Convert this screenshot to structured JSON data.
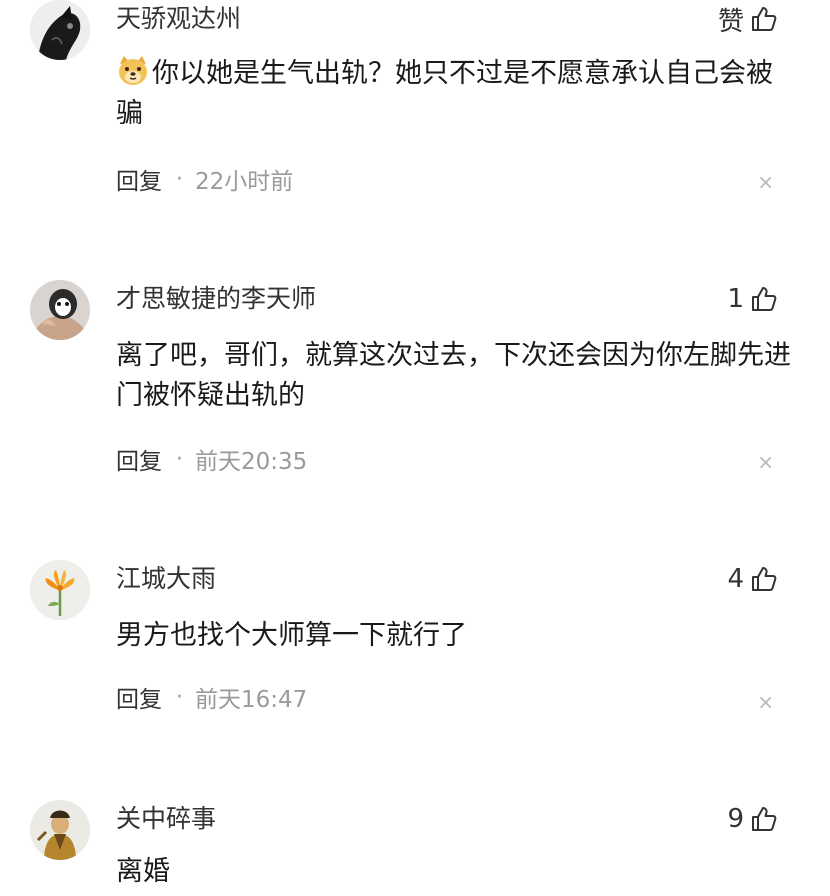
{
  "comments": [
    {
      "username": "天骄观达州",
      "like_label": "赞",
      "text": "你以她是生气出轨？她只不过是不愿意承认自己会被骗",
      "reply_label": "回复",
      "separator": "·",
      "time": "22小时前",
      "close_glyph": "×"
    },
    {
      "username": "才思敏捷的李天师",
      "like_label": "1",
      "text": "离了吧，哥们，就算这次过去，下次还会因为你左脚先进门被怀疑出轨的",
      "reply_label": "回复",
      "separator": "·",
      "time": "前天20:35",
      "close_glyph": "×"
    },
    {
      "username": "江城大雨",
      "like_label": "4",
      "text": "男方也找个大师算一下就行了",
      "reply_label": "回复",
      "separator": "·",
      "time": "前天16:47",
      "close_glyph": "×"
    },
    {
      "username": "关中碎事",
      "like_label": "9",
      "text": "离婚"
    }
  ],
  "icons": {
    "like": "thumbs-up-icon",
    "emoji": "dog-face-emoji",
    "close": "close-icon"
  },
  "colors": {
    "text": "#1a1a1a",
    "muted": "#9a9a9a",
    "close": "#b8b8b8"
  }
}
